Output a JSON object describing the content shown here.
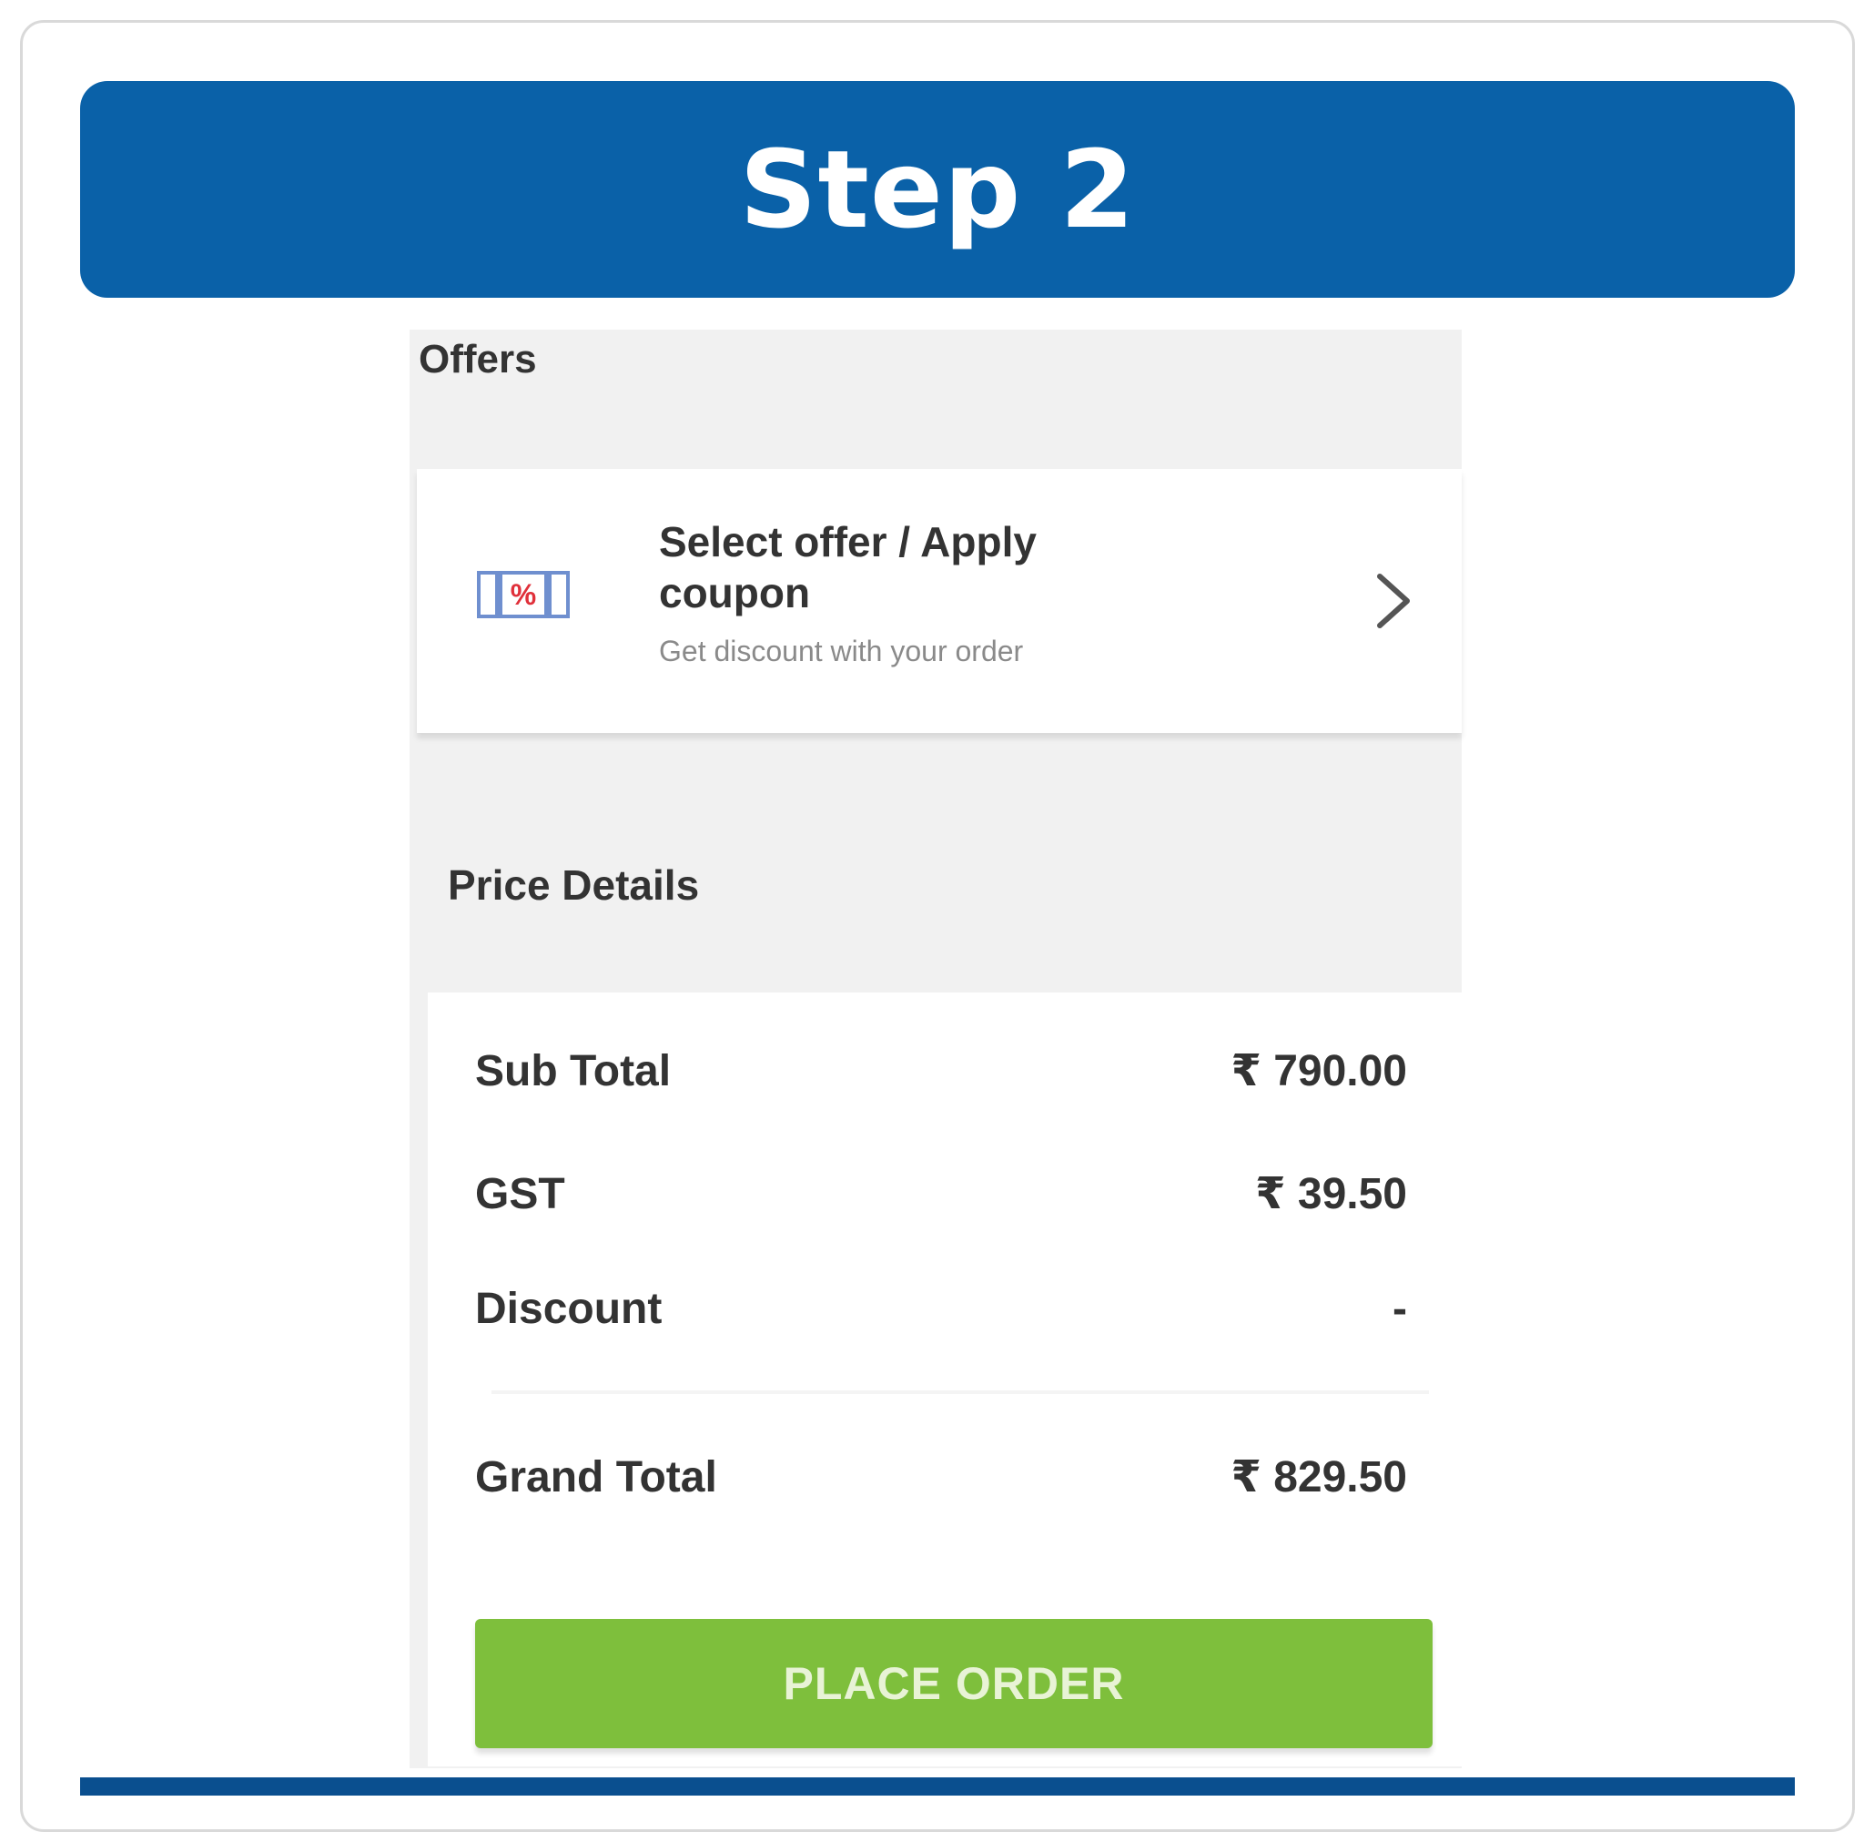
{
  "banner": {
    "title": "Step 2"
  },
  "offers": {
    "section_title": "Offers",
    "card": {
      "title": "Select offer / Apply coupon",
      "subtitle": "Get discount with your order",
      "icon": "coupon-icon",
      "icon_text": "%",
      "chevron": "chevron-right-icon"
    }
  },
  "price_details": {
    "section_title": "Price Details",
    "rows": [
      {
        "label": "Sub Total",
        "value": "₹ 790.00"
      },
      {
        "label": "GST",
        "value": "₹ 39.50"
      },
      {
        "label": "Discount",
        "value": "-"
      }
    ],
    "grand_total": {
      "label": "Grand Total",
      "value": "₹ 829.50"
    }
  },
  "actions": {
    "place_order": "PLACE ORDER"
  },
  "colors": {
    "banner": "#0a61a8",
    "button": "#7ebf3c",
    "panel_bg": "#f1f1f1"
  }
}
